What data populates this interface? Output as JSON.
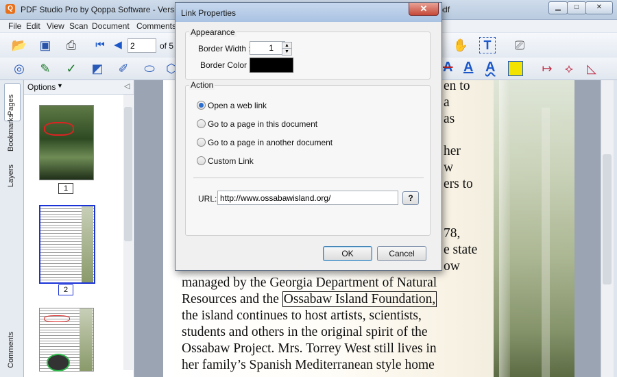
{
  "app": {
    "title_left": "PDF Studio Pro by Qoppa Software - Versi",
    "title_right": "arkup.pdf",
    "icon_letter": "Q"
  },
  "menu": [
    "File",
    "Edit",
    "View",
    "Scan",
    "Document",
    "Comments"
  ],
  "toolbar": {
    "page_value": "2",
    "page_of": "of 5"
  },
  "left_tabs": [
    "Pages",
    "Bookmarks",
    "Layers",
    "Comments"
  ],
  "thumbnails": {
    "options_label": "Options",
    "pages": [
      {
        "number": "1",
        "selected": false
      },
      {
        "number": "2",
        "selected": true
      }
    ]
  },
  "document": {
    "right_fragments": [
      "en to",
      "a",
      "as",
      "her",
      "w",
      "ers to",
      "78,",
      "e state",
      "ow"
    ],
    "lines": [
      "managed by the Georgia Department of Natural",
      "Resources and the",
      "the island continues to host artists, scientists,",
      "students and others in the original spirit of the",
      "Ossabaw Project. Mrs. Torrey West still lives in",
      "her family’s Spanish Mediterranean style home"
    ],
    "link_text": "Ossabaw Island Foundation,"
  },
  "dialog": {
    "title": "Link Properties",
    "appearance": {
      "group_label": "Appearance",
      "border_width_label": "Border Width :",
      "border_width_value": "1",
      "border_color_label": "Border Color :",
      "border_color": "#000000"
    },
    "action": {
      "group_label": "Action",
      "options": [
        {
          "label": "Open a web link",
          "selected": true
        },
        {
          "label": "Go to a page in this document",
          "selected": false
        },
        {
          "label": "Go to a page in another document",
          "selected": false
        },
        {
          "label": "Custom Link",
          "selected": false
        }
      ],
      "url_label": "URL:",
      "url_value": "http://www.ossabawisland.org/",
      "help_label": "?"
    },
    "ok_label": "OK",
    "cancel_label": "Cancel"
  },
  "colors": {
    "accent": "#2b6ed0",
    "selection_border": "#1a33d6"
  }
}
